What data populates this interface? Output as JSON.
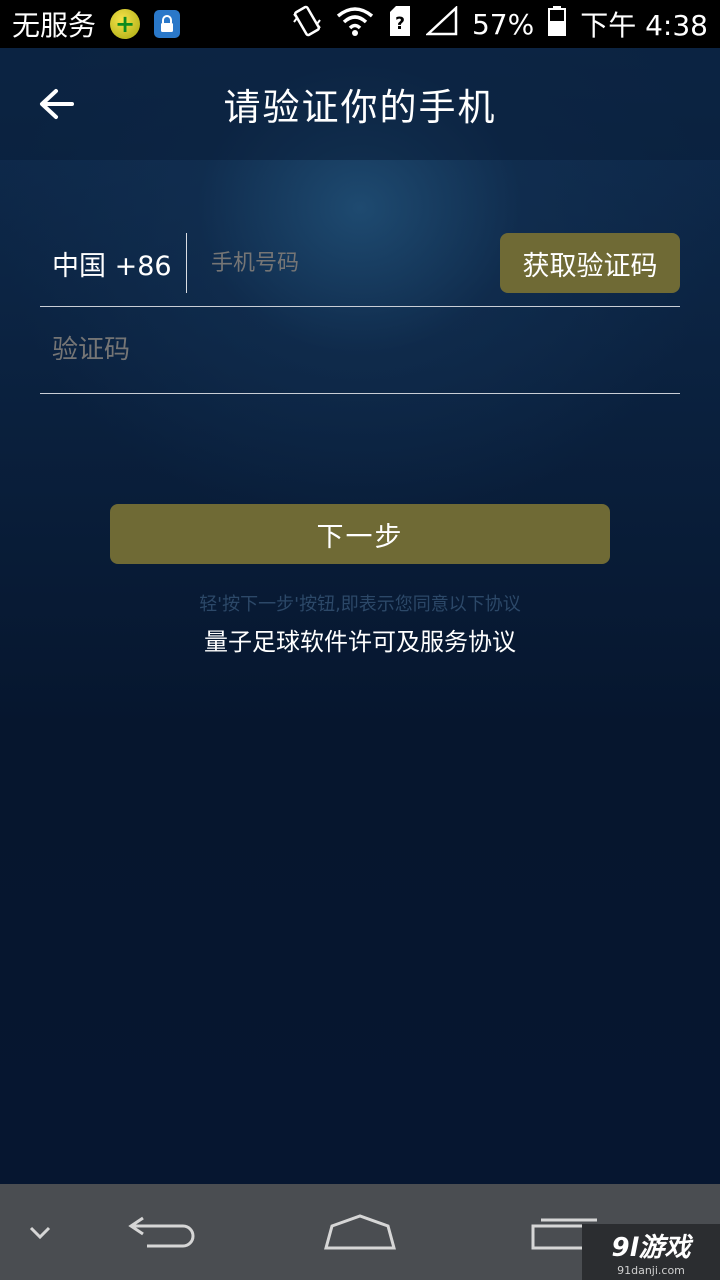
{
  "status_bar": {
    "carrier": "无服务",
    "battery": "57%",
    "time": "下午 4:38"
  },
  "header": {
    "title": "请验证你的手机"
  },
  "form": {
    "country_code": "中国 +86",
    "phone_placeholder": "手机号码",
    "get_code_label": "获取验证码",
    "code_placeholder": "验证码"
  },
  "actions": {
    "next_label": "下一步",
    "hint": "轻'按下一步'按钮,即表示您同意以下协议",
    "agreement_link": "量子足球软件许可及服务协议"
  },
  "watermark": {
    "main": "9l游戏",
    "sub": "91danji.com"
  },
  "colors": {
    "accent_button": "#6f6a35",
    "background": "#0a1a33"
  }
}
